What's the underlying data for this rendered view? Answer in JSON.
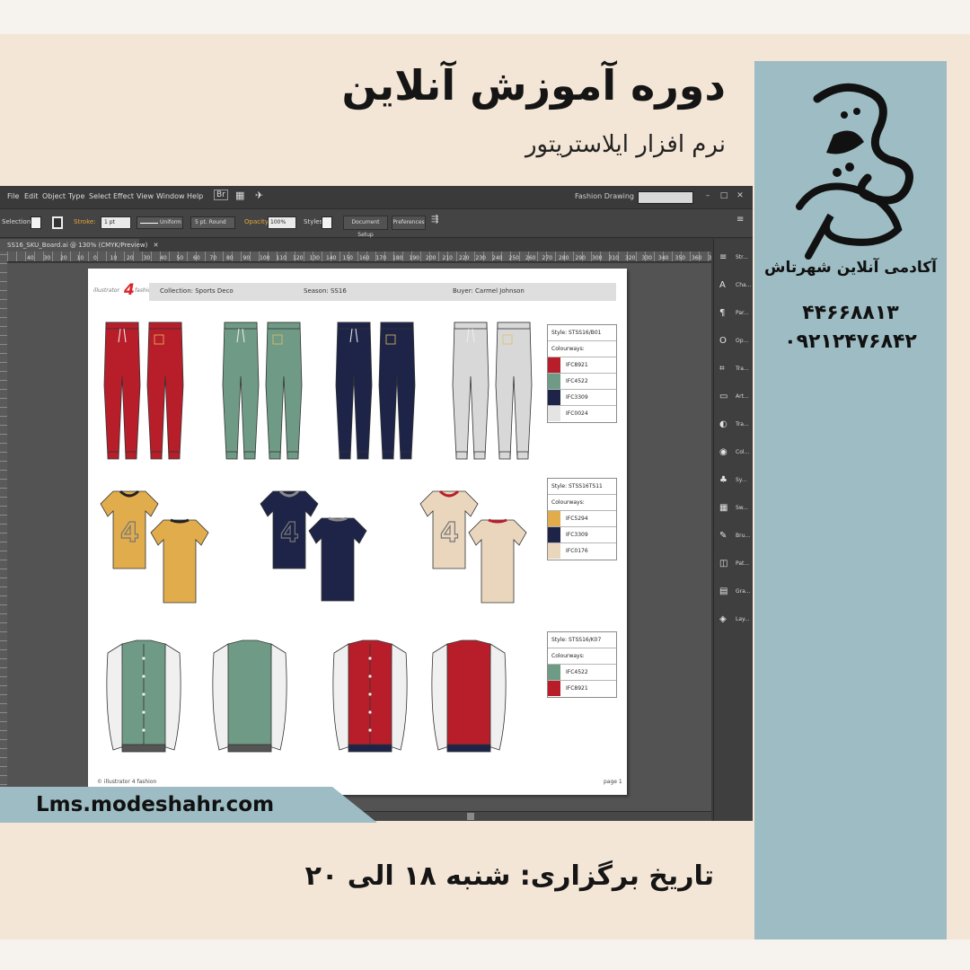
{
  "poster": {
    "title": "دوره آموزش آنلاین",
    "subtitle": "نرم افزار ایلاستریتور",
    "academy_name": "آکادمی آنلاین شهرتاش",
    "phone_1": "۴۴۶۶۸۸۱۳",
    "phone_2": "۰۹۲۱۲۴۷۶۸۴۲",
    "url": "Lms.modeshahr.com",
    "date_text": "تاریخ برگزاری: شنبه ۱۸ الی ۲۰",
    "logo_mark": "شهرتاش"
  },
  "colors": {
    "poster_bg": "#f4e6d6",
    "sidebar": "#9dbcc3",
    "red": "#b81e2a",
    "green": "#6f9b86",
    "navy": "#1d2448",
    "grey": "#d8d8d8",
    "mustard": "#e0ac4c",
    "beige": "#ead6bd"
  },
  "app": {
    "menu": [
      "File",
      "Edit",
      "Object",
      "Type",
      "Select",
      "Effect",
      "View",
      "Window",
      "Help"
    ],
    "workspace": "Fashion Drawing",
    "control": {
      "selection": "Selection",
      "stroke": "Stroke:",
      "stroke_weight": "1 pt",
      "uniform": "Uniform",
      "brush": "5 pt. Round",
      "opacity": "Opacity:",
      "opacity_value": "100%",
      "styles": "Styles:",
      "document_setup": "Document Setup",
      "preferences": "Preferences"
    },
    "document_tab": "SS16_SKU_Board.ai @ 130% (CMYK/Preview)",
    "ruler_numbers": [
      "40",
      "30",
      "20",
      "10",
      "0",
      "10",
      "20",
      "30",
      "40",
      "50",
      "60",
      "70",
      "80",
      "90",
      "100",
      "110",
      "120",
      "130",
      "140",
      "150",
      "160",
      "170",
      "180",
      "190",
      "200",
      "210",
      "220",
      "230",
      "240",
      "250",
      "260",
      "270",
      "280",
      "290",
      "300",
      "310",
      "320",
      "330",
      "340",
      "350",
      "360",
      "370"
    ],
    "panels": [
      {
        "icon": "stroke-icon",
        "glyph": "≡",
        "label": "Str..."
      },
      {
        "icon": "character-icon",
        "glyph": "A",
        "label": "Cha..."
      },
      {
        "icon": "paragraph-icon",
        "glyph": "¶",
        "label": "Par..."
      },
      {
        "icon": "opentype-icon",
        "glyph": "O",
        "label": "Op..."
      },
      {
        "icon": "transform-icon",
        "glyph": "⌗",
        "label": "Tra..."
      },
      {
        "icon": "artboards-icon",
        "glyph": "▭",
        "label": "Art..."
      },
      {
        "icon": "transparency-icon",
        "glyph": "◐",
        "label": "Tra..."
      },
      {
        "icon": "color-icon",
        "glyph": "◉",
        "label": "Col..."
      },
      {
        "icon": "symbols-icon",
        "glyph": "♣",
        "label": "Sy..."
      },
      {
        "icon": "swatches-icon",
        "glyph": "▦",
        "label": "Sw..."
      },
      {
        "icon": "brushes-icon",
        "glyph": "✎",
        "label": "Bru..."
      },
      {
        "icon": "pathfinder-icon",
        "glyph": "◫",
        "label": "Pat..."
      },
      {
        "icon": "gradient-icon",
        "glyph": "▤",
        "label": "Gra..."
      },
      {
        "icon": "layers-icon",
        "glyph": "◈",
        "label": "Lay..."
      }
    ]
  },
  "board": {
    "brand_text": "illustrator",
    "brand_number": "4",
    "brand_suffix": "fashion",
    "collection": "Collection: Sports Deco",
    "season": "Season: SS16",
    "buyer": "Buyer: Carmel Johnson",
    "footer": "© illustrator 4 fashion",
    "page": "page 1",
    "tee_number": "4",
    "styles": [
      {
        "style": "Style: STSS16/B01",
        "colourways_label": "Colourways:",
        "colourways": [
          {
            "code": "IFC8921",
            "color": "#b81e2a"
          },
          {
            "code": "IFC4522",
            "color": "#6f9b86"
          },
          {
            "code": "IFC3309",
            "color": "#1d2448"
          },
          {
            "code": "IFC0024",
            "color": "#e4e4e4"
          }
        ]
      },
      {
        "style": "Style: STSS16TS11",
        "colourways_label": "Colourways:",
        "colourways": [
          {
            "code": "IFC5294",
            "color": "#e0ac4c"
          },
          {
            "code": "IFC3309",
            "color": "#1d2448"
          },
          {
            "code": "IFC0176",
            "color": "#ead6bd"
          }
        ]
      },
      {
        "style": "Style: STSS16/K07",
        "colourways_label": "Colourways:",
        "colourways": [
          {
            "code": "IFC4522",
            "color": "#6f9b86"
          },
          {
            "code": "IFC8921",
            "color": "#b81e2a"
          }
        ]
      }
    ]
  }
}
